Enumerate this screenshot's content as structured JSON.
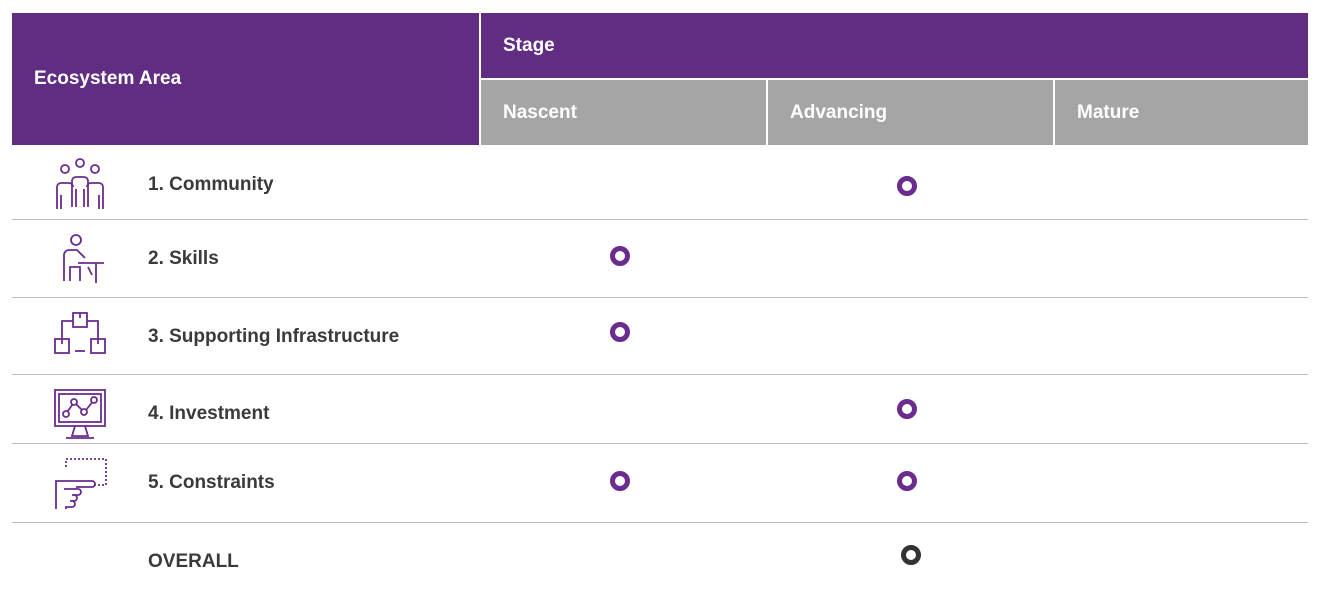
{
  "header": {
    "area_label": "Ecosystem Area",
    "stage_label": "Stage",
    "stages": [
      "Nascent",
      "Advancing",
      "Mature"
    ]
  },
  "rows": [
    {
      "label": "1. Community",
      "icon": "community-icon",
      "markers": [
        "Advancing"
      ]
    },
    {
      "label": "2. Skills",
      "icon": "skills-icon",
      "markers": [
        "Nascent"
      ]
    },
    {
      "label": "3. Supporting Infrastructure",
      "icon": "infrastructure-icon",
      "markers": [
        "Nascent"
      ]
    },
    {
      "label": "4. Investment",
      "icon": "investment-icon",
      "markers": [
        "Advancing"
      ]
    },
    {
      "label": "5. Constraints",
      "icon": "constraints-icon",
      "markers": [
        "Nascent",
        "Advancing"
      ]
    },
    {
      "label": "OVERALL",
      "icon": "",
      "markers": [
        "Advancing"
      ]
    }
  ],
  "colors": {
    "header_purple": "#612d82",
    "subheader_gray": "#a5a5a5",
    "marker_purple": "#6a2c8f",
    "overall_marker": "#333333"
  }
}
